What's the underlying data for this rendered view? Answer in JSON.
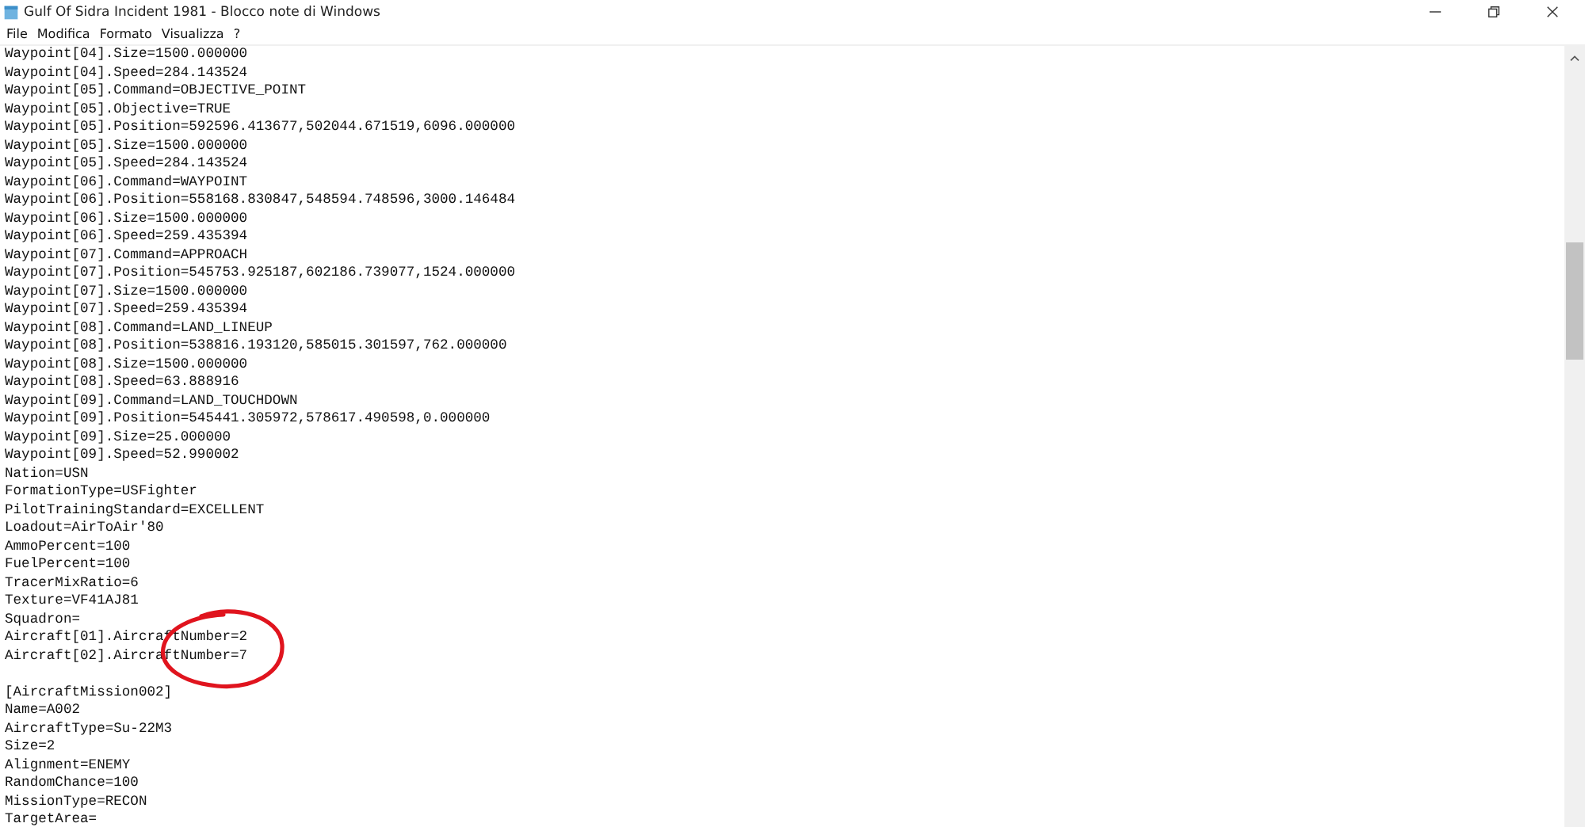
{
  "window": {
    "title": "Gulf Of Sidra Incident 1981 - Blocco note di Windows"
  },
  "menu": [
    "File",
    "Modifica",
    "Formato",
    "Visualizza",
    "?"
  ],
  "editor": {
    "blocks": [
      {
        "lines": [
          "Waypoint[04].Size=1500.000000",
          "Waypoint[04].Speed=284.143524",
          "Waypoint[05].Command=OBJECTIVE_POINT",
          "Waypoint[05].Objective=TRUE",
          "Waypoint[05].Position=592596.413677,502044.671519,6096.000000",
          "Waypoint[05].Size=1500.000000",
          "Waypoint[05].Speed=284.143524",
          "Waypoint[06].Command=WAYPOINT",
          "Waypoint[06].Position=558168.830847,548594.748596,3000.146484",
          "Waypoint[06].Size=1500.000000",
          "Waypoint[06].Speed=259.435394",
          "Waypoint[07].Command=APPROACH",
          "Waypoint[07].Position=545753.925187,602186.739077,1524.000000",
          "Waypoint[07].Size=1500.000000",
          "Waypoint[07].Speed=259.435394",
          "Waypoint[08].Command=LAND_LINEUP",
          "Waypoint[08].Position=538816.193120,585015.301597,762.000000",
          "Waypoint[08].Size=1500.000000",
          "Waypoint[08].Speed=63.888916",
          "Waypoint[09].Command=LAND_TOUCHDOWN",
          "Waypoint[09].Position=545441.305972,578617.490598,0.000000",
          "Waypoint[09].Size=25.000000",
          "Waypoint[09].Speed=52.990002",
          "Nation=USN",
          "FormationType=USFighter",
          "PilotTrainingStandard=EXCELLENT",
          "Loadout=AirToAir'80",
          "AmmoPercent=100",
          "FuelPercent=100",
          "TracerMixRatio=6",
          "Texture=VF41AJ81",
          "Squadron=",
          "Aircraft[01].AircraftNumber=2",
          "Aircraft[02].AircraftNumber=7"
        ]
      },
      {
        "lines": [
          "[AircraftMission002]",
          "Name=A002",
          "AircraftType=Su-22M3",
          "Size=2",
          "Alignment=ENEMY",
          "RandomChance=100",
          "MissionType=RECON",
          "TargetArea="
        ]
      }
    ]
  }
}
